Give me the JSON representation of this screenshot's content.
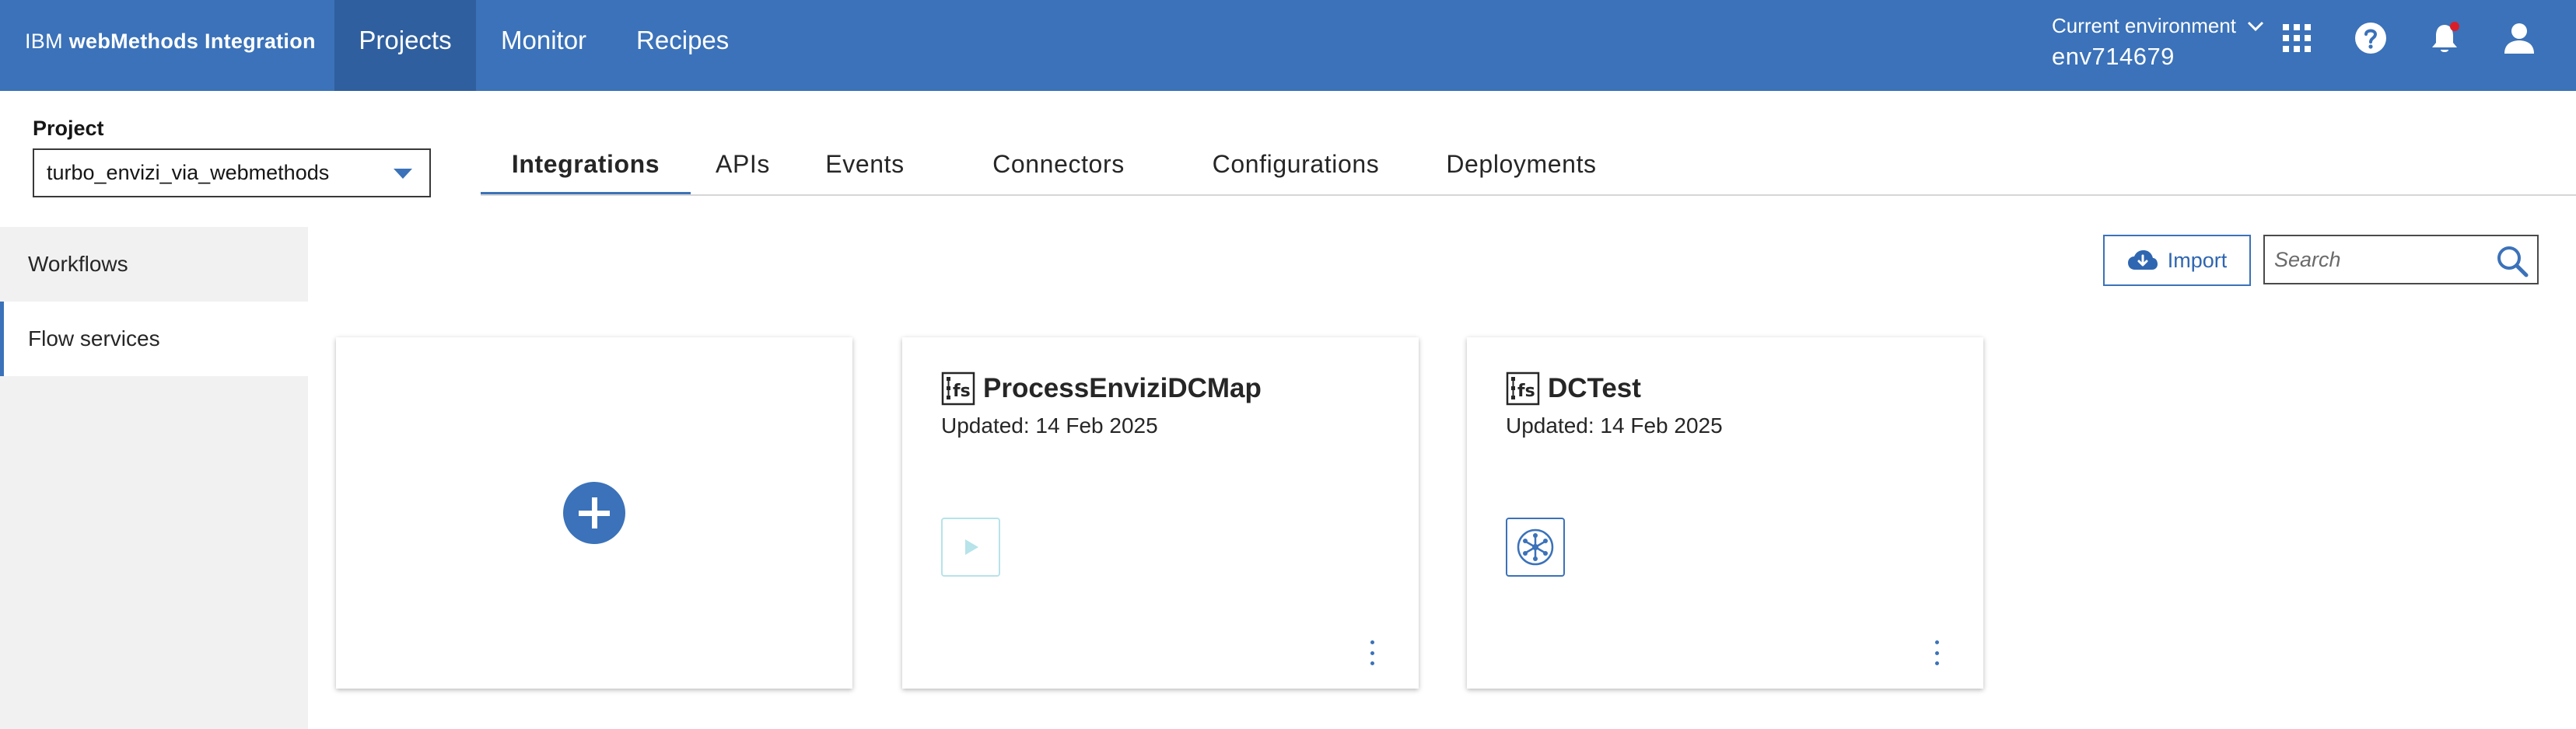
{
  "header": {
    "brand_prefix": "IBM",
    "brand_product": "webMethods Integration",
    "nav": [
      {
        "label": "Projects",
        "active": true
      },
      {
        "label": "Monitor",
        "active": false
      },
      {
        "label": "Recipes",
        "active": false
      }
    ],
    "environment_label": "Current environment",
    "environment_value": "env714679",
    "icons": [
      "apps-grid-icon",
      "help-icon",
      "notification-bell-icon",
      "user-avatar-icon"
    ],
    "notification_dot_color": "#da1e28",
    "color": "#3b72b9"
  },
  "project": {
    "label": "Project",
    "selected": "turbo_envizi_via_webmethods"
  },
  "tabs": [
    {
      "label": "Integrations",
      "active": true
    },
    {
      "label": "APIs",
      "active": false
    },
    {
      "label": "Events",
      "active": false
    },
    {
      "label": "Connectors",
      "active": false
    },
    {
      "label": "Configurations",
      "active": false
    },
    {
      "label": "Deployments",
      "active": false
    }
  ],
  "sidebar": {
    "items": [
      {
        "label": "Workflows",
        "active": false
      },
      {
        "label": "Flow services",
        "active": true
      }
    ]
  },
  "toolbar": {
    "import_label": "Import",
    "search_placeholder": "Search",
    "search_value": ""
  },
  "cards": [
    {
      "title": "ProcessEnviziDCMap",
      "updated": "Updated: 14 Feb 2025",
      "icon": "run-play-icon"
    },
    {
      "title": "DCTest",
      "updated": "Updated: 14 Feb 2025",
      "icon": "flow-network-icon"
    }
  ],
  "accent_color": "#3b72b9"
}
